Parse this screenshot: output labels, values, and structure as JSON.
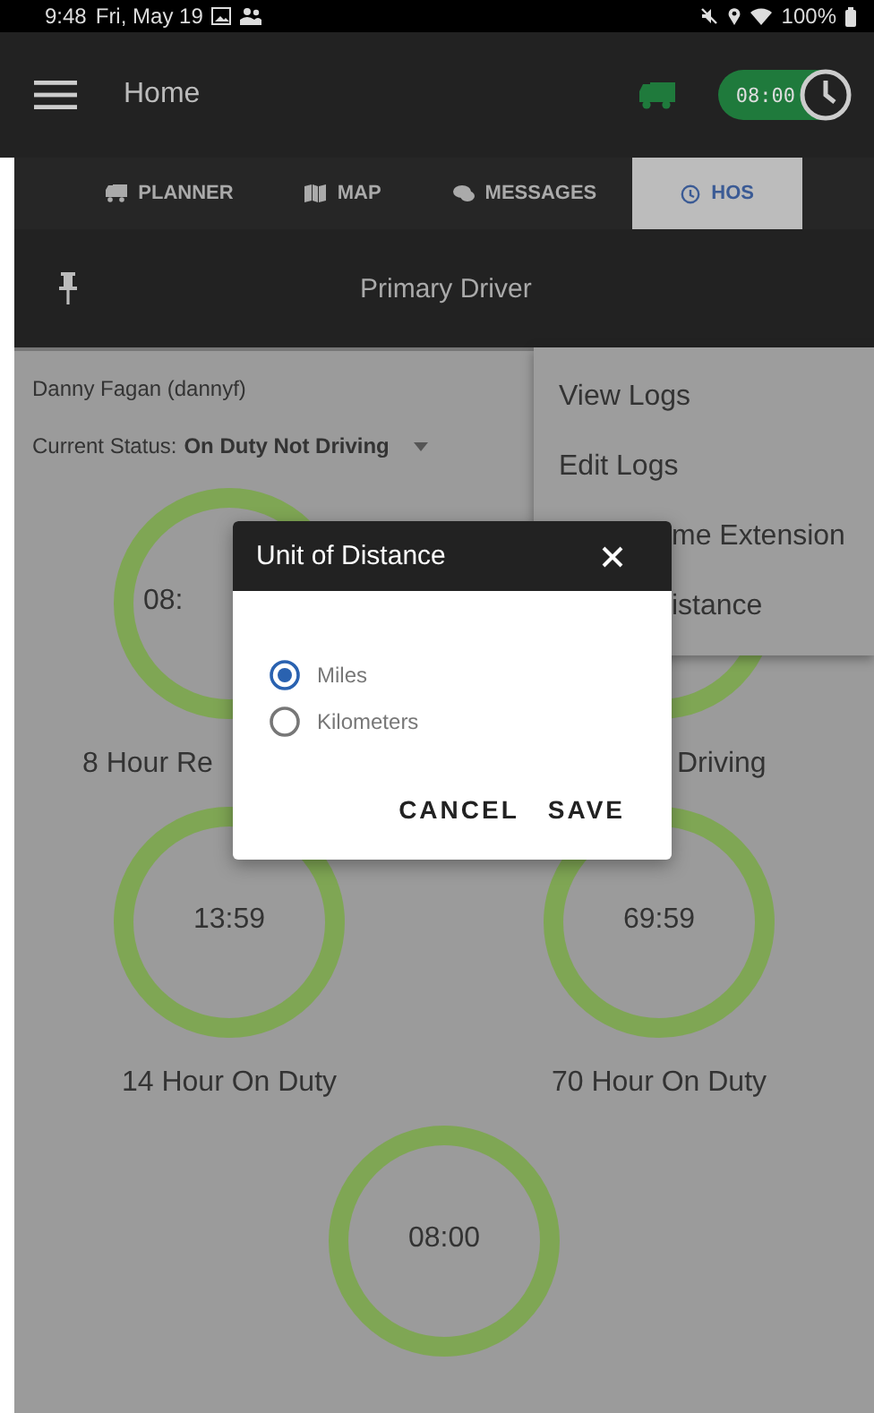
{
  "status_bar": {
    "time": "9:48",
    "date": "Fri, May 19",
    "battery": "100%"
  },
  "header": {
    "title": "Home",
    "timer": {
      "label": "08:00",
      "on": true
    }
  },
  "tabs": [
    {
      "label": "PLANNER",
      "selected": false
    },
    {
      "label": "MAP",
      "selected": false
    },
    {
      "label": "MESSAGES",
      "selected": false
    },
    {
      "label": "HOS",
      "selected": true
    }
  ],
  "driver_bar": {
    "title": "Primary Driver"
  },
  "driver": {
    "name": "Danny Fagan  (dannyf)",
    "status_label": "Current Status:",
    "status_value": "On Duty Not Driving"
  },
  "gauges": [
    {
      "time": "08:",
      "label": "8 Hour Re"
    },
    {
      "label": "Driving"
    },
    {
      "time": "13:59",
      "label": "14 Hour On Duty"
    },
    {
      "time": "69:59",
      "label": "70 Hour On Duty"
    },
    {
      "time": "08:00"
    }
  ],
  "menu": {
    "items": [
      {
        "label": "View Logs"
      },
      {
        "label": "Edit Logs"
      },
      {
        "label": "me Extension"
      },
      {
        "label": "istance"
      }
    ]
  },
  "dialog": {
    "title": "Unit of Distance",
    "options": [
      {
        "label": "Miles",
        "selected": true
      },
      {
        "label": "Kilometers",
        "selected": false
      }
    ],
    "buttons": [
      "CANCEL",
      "SAVE"
    ]
  }
}
